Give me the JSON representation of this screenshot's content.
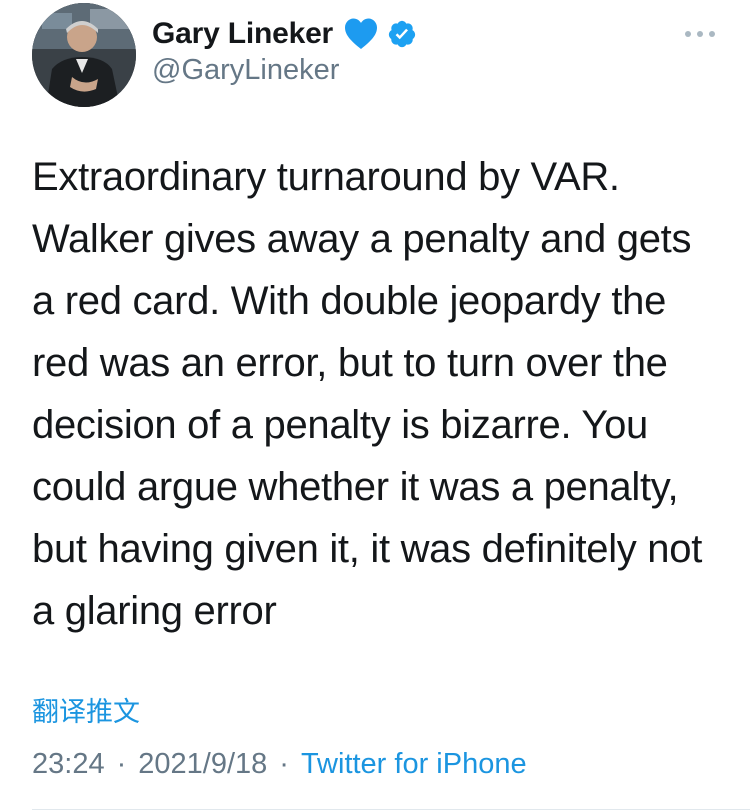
{
  "tweet": {
    "display_name": "Gary Lineker",
    "handle": "@GaryLineker",
    "text": "Extraordinary turnaround by VAR. Walker gives away a penalty and gets a red card. With double jeopardy the red was an error, but to turn over the decision of a penalty is bizarre. You could argue whether it was a penalty, but having given it, it was definitely not a glaring error",
    "translate_label": "翻译推文",
    "time": "23:24",
    "separator": "·",
    "date": "2021/9/18",
    "source": "Twitter for iPhone"
  },
  "icons": {
    "heart": "blue-heart-icon",
    "verified": "verified-badge-icon",
    "more": "more-options-icon"
  },
  "colors": {
    "link_blue": "#1b95e0",
    "heart_blue": "#1d9bf0",
    "verified_blue": "#1da1f2",
    "secondary_text": "#657786",
    "primary_text": "#14171a"
  }
}
